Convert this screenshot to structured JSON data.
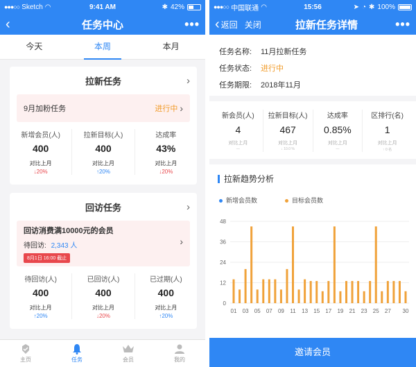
{
  "colors": {
    "primary": "#2f87f4",
    "orange": "#f19a27",
    "red": "#e8474c",
    "bar": "#f0a23a"
  },
  "left": {
    "status": {
      "carrier": "Sketch",
      "time": "9:41 AM",
      "battery": "42%"
    },
    "nav": {
      "title": "任务中心",
      "back_icon": "chevron-left-icon",
      "more": "•••"
    },
    "tabs": [
      {
        "label": "今天",
        "active": false
      },
      {
        "label": "本周",
        "active": true
      },
      {
        "label": "本月",
        "active": false
      }
    ],
    "card1": {
      "title": "拉新任务",
      "sub_name": "9月加粉任务",
      "sub_state": "进行中",
      "stats": [
        {
          "label": "新增会员(人)",
          "value": "400",
          "compare": "对比上月",
          "change": "↓20%",
          "dir": "down"
        },
        {
          "label": "拉新目标(人)",
          "value": "400",
          "compare": "对比上月",
          "change": "↑20%",
          "dir": "up"
        },
        {
          "label": "达成率",
          "value": "43%",
          "compare": "对比上月",
          "change": "↓20%",
          "dir": "down"
        }
      ]
    },
    "card2": {
      "title": "回访任务",
      "sub_title": "回访消费满10000元的会员",
      "pending_label": "待回访:",
      "pending_value": "2,343 人",
      "deadline": "8月1日 16:00 截止",
      "stats": [
        {
          "label": "待回访(人)",
          "value": "400",
          "compare": "对比上月",
          "change": "↑20%",
          "dir": "up"
        },
        {
          "label": "已回访(人)",
          "value": "400",
          "compare": "对比上月",
          "change": "↓20%",
          "dir": "down"
        },
        {
          "label": "已过期(人)",
          "value": "400",
          "compare": "对比上月",
          "change": "↑20%",
          "dir": "up"
        }
      ]
    },
    "tabbar": [
      {
        "label": "主页",
        "icon": "home-icon",
        "active": false
      },
      {
        "label": "任务",
        "icon": "bell-icon",
        "active": true
      },
      {
        "label": "会员",
        "icon": "crown-icon",
        "active": false
      },
      {
        "label": "我的",
        "icon": "person-icon",
        "active": false
      }
    ]
  },
  "right": {
    "status": {
      "carrier": "中国联通",
      "time": "15:56",
      "battery": "100%"
    },
    "nav": {
      "back": "返回",
      "close": "关闭",
      "title": "拉新任务详情",
      "more": "•••"
    },
    "info": [
      {
        "key": "任务名称:",
        "value": "11月拉新任务",
        "highlight": false
      },
      {
        "key": "任务状态:",
        "value": "进行中",
        "highlight": true
      },
      {
        "key": "任务期限:",
        "value": "2018年11月",
        "highlight": false
      }
    ],
    "metrics": [
      {
        "label": "新会员(人)",
        "value": "4",
        "compare": "对比上月",
        "tiny": "—"
      },
      {
        "label": "拉新目标(人)",
        "value": "467",
        "compare": "对比上月",
        "tiny": "↓ 10.0 %"
      },
      {
        "label": "达成率",
        "value": "0.85%",
        "compare": "对比上月",
        "tiny": "—"
      },
      {
        "label": "区排行(名)",
        "value": "1",
        "compare": "对比上月",
        "tiny": "↑ 0 名"
      }
    ],
    "chart_title": "拉新趋势分析",
    "invite_label": "邀请会员"
  },
  "chart_data": {
    "type": "bar",
    "legend": [
      {
        "name": "新增会员数",
        "color": "#2f87f4"
      },
      {
        "name": "目标会员数",
        "color": "#f0a23a"
      }
    ],
    "x": [
      "01",
      "02",
      "03",
      "04",
      "05",
      "06",
      "07",
      "08",
      "09",
      "10",
      "11",
      "12",
      "13",
      "14",
      "15",
      "16",
      "17",
      "18",
      "19",
      "20",
      "21",
      "22",
      "23",
      "24",
      "25",
      "26",
      "27",
      "28",
      "29",
      "30"
    ],
    "xtick_labels": [
      "01",
      "03",
      "05",
      "07",
      "09",
      "11",
      "13",
      "15",
      "17",
      "19",
      "21",
      "23",
      "25",
      "27",
      "30"
    ],
    "series": [
      {
        "name": "新增会员数",
        "values": [
          0,
          0,
          0,
          0,
          0,
          0,
          0,
          0,
          0,
          0,
          0,
          0,
          0,
          0,
          0,
          0,
          0,
          0,
          0,
          0,
          0,
          0,
          0,
          0,
          0,
          0,
          0,
          0,
          0,
          0
        ]
      },
      {
        "name": "目标会员数",
        "values": [
          14,
          8,
          20,
          45,
          8,
          14,
          14,
          14,
          8,
          20,
          45,
          8,
          14,
          13,
          13,
          7,
          13,
          45,
          7,
          13,
          13,
          13,
          7,
          13,
          45,
          7,
          13,
          13,
          13,
          7
        ]
      }
    ],
    "yticks": [
      0,
      12,
      24,
      36,
      48
    ],
    "ylim": [
      0,
      48
    ]
  }
}
